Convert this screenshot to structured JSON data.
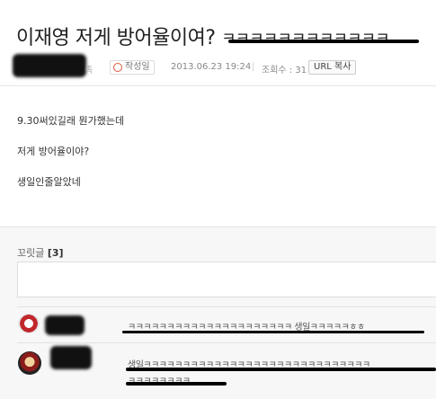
{
  "post": {
    "title": "이재영 저게 방어율이여?",
    "title_suffix": "ㅋㅋㅋㅋㅋㅋㅋㅋㅋㅋㅋㅋ",
    "author_suffix": "족",
    "date_label": "작성일",
    "date": "2013.06.23 19:24",
    "views_label": "조회수 : 31",
    "url_copy": "URL 복사",
    "body_lines": [
      "9.30써있길래 뭔가했는데",
      "저게 방어율이야?",
      "생일인줄알았네"
    ]
  },
  "comments": {
    "label": "꼬릿글",
    "count": "[3]",
    "items": [
      {
        "text": "ㅋㅋㅋㅋㅋㅋㅋㅋㅋㅋㅋㅋㅋㅋㅋㅋㅋㅋㅋㅋㅋ 생일ㅋㅋㅋㅋㅋㅎㅎ"
      },
      {
        "text": "생일ㅋㅋㅋㅋㅋㅋㅋㅋㅋㅋㅋㅋㅋㅋㅋㅋㅋㅋㅋㅋㅋㅋㅋㅋㅋㅋㅋㅋㅋ",
        "text2": "ㅋㅋㅋㅋㅋㅋㅋㅋ"
      }
    ]
  },
  "colors": {
    "badge_clock": "#e05a3a",
    "censor": "#000000",
    "panel_bg": "#f7f7f7"
  }
}
